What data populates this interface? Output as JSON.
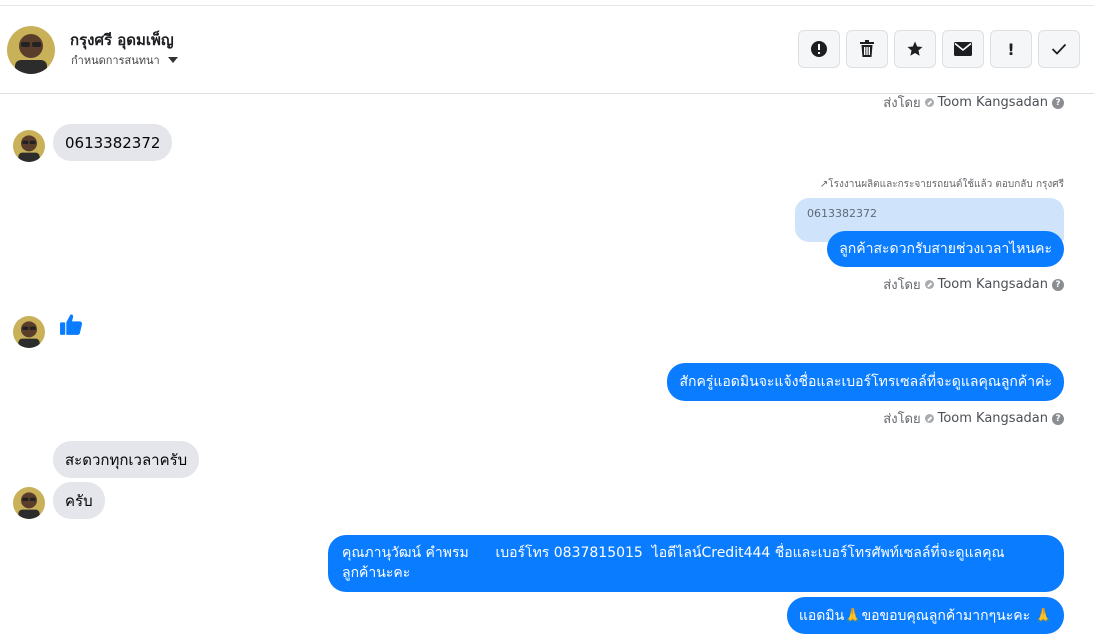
{
  "header": {
    "contact_name": "กรุงศรี อุดมเพ็ญ",
    "assign_label": "กำหนดการสนทนา",
    "toolbar": [
      {
        "icon": "alert-circle-icon",
        "action": "report"
      },
      {
        "icon": "trash-icon",
        "action": "delete"
      },
      {
        "icon": "star-icon",
        "action": "star"
      },
      {
        "icon": "envelope-icon",
        "action": "mark-unread"
      },
      {
        "icon": "exclamation-icon",
        "action": "spam",
        "glyph": "!"
      },
      {
        "icon": "check-icon",
        "action": "done"
      }
    ]
  },
  "colors": {
    "outgoing_bubble": "#0a7cff",
    "incoming_bubble": "#e4e6eb",
    "quoted_bubble": "#cfe3fb",
    "like_icon": "#0a7cff"
  },
  "sent_by": {
    "prefix": "ส่งโดย",
    "agent": "Toom Kangsadan"
  },
  "messages": {
    "m1_in": "0613382372",
    "reply_note": "↗โรงงานผลิตและกระจายรถยนต์ใช้แล้ว ตอบกลับ กรุงศรี",
    "quoted_text": "0613382372",
    "m2_out": "ลูกค้าสะดวกรับสายช่วงเวลาไหนคะ",
    "m3_in_like": "thumbs-up-icon",
    "m4_out": "สักครู่แอดมินจะแจ้งชื่อและเบอร์โทรเซลล์ที่จะดูแลคุณลูกค้าค่ะ",
    "m5_in": "สะดวกทุกเวลาครับ",
    "m6_in": "ครับ",
    "m7_out_line1": "คุณภานุวัฒน์ คำพรม      เบอร์โทร 0837815015  ไอดีไลน์Credit444 ชื่อและเบอร์โทรศัพท์เซลล์ที่จะดูแลคุณ",
    "m7_out_line2": "ลูกค้านะคะ",
    "m8_out": "แอดมิน🙏ขอขอบคุณลูกค้ามากๆนะคะ 🙏"
  }
}
